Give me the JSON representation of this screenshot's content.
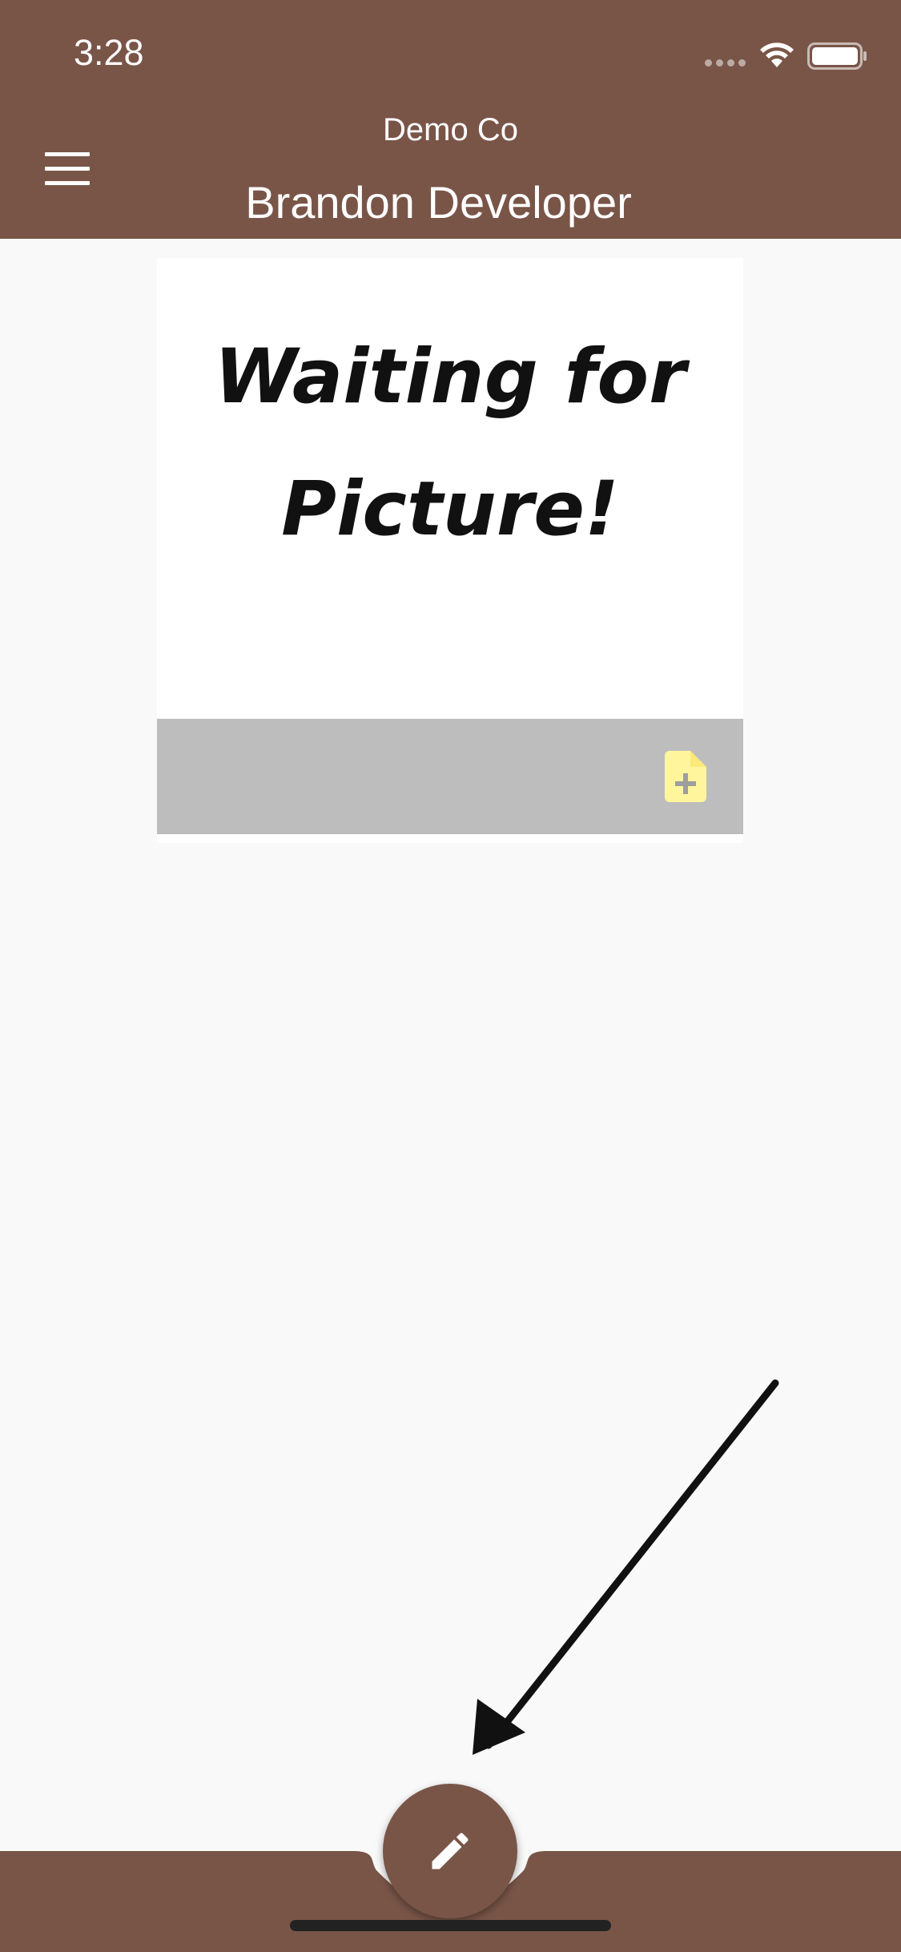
{
  "status_bar": {
    "time": "3:28"
  },
  "app_bar": {
    "company": "Demo Co",
    "user": "Brandon Developer",
    "menu_icon": "hamburger-menu-icon"
  },
  "card": {
    "placeholder_line1": "Waiting for",
    "placeholder_line2": "Picture!",
    "action_icon": "note-add-icon"
  },
  "fab": {
    "icon": "edit-pencil-icon"
  },
  "colors": {
    "primary": "#795548",
    "background": "#f9f9f9",
    "card_footer": "#bdbdbd",
    "accent_icon": "#fff59d"
  }
}
